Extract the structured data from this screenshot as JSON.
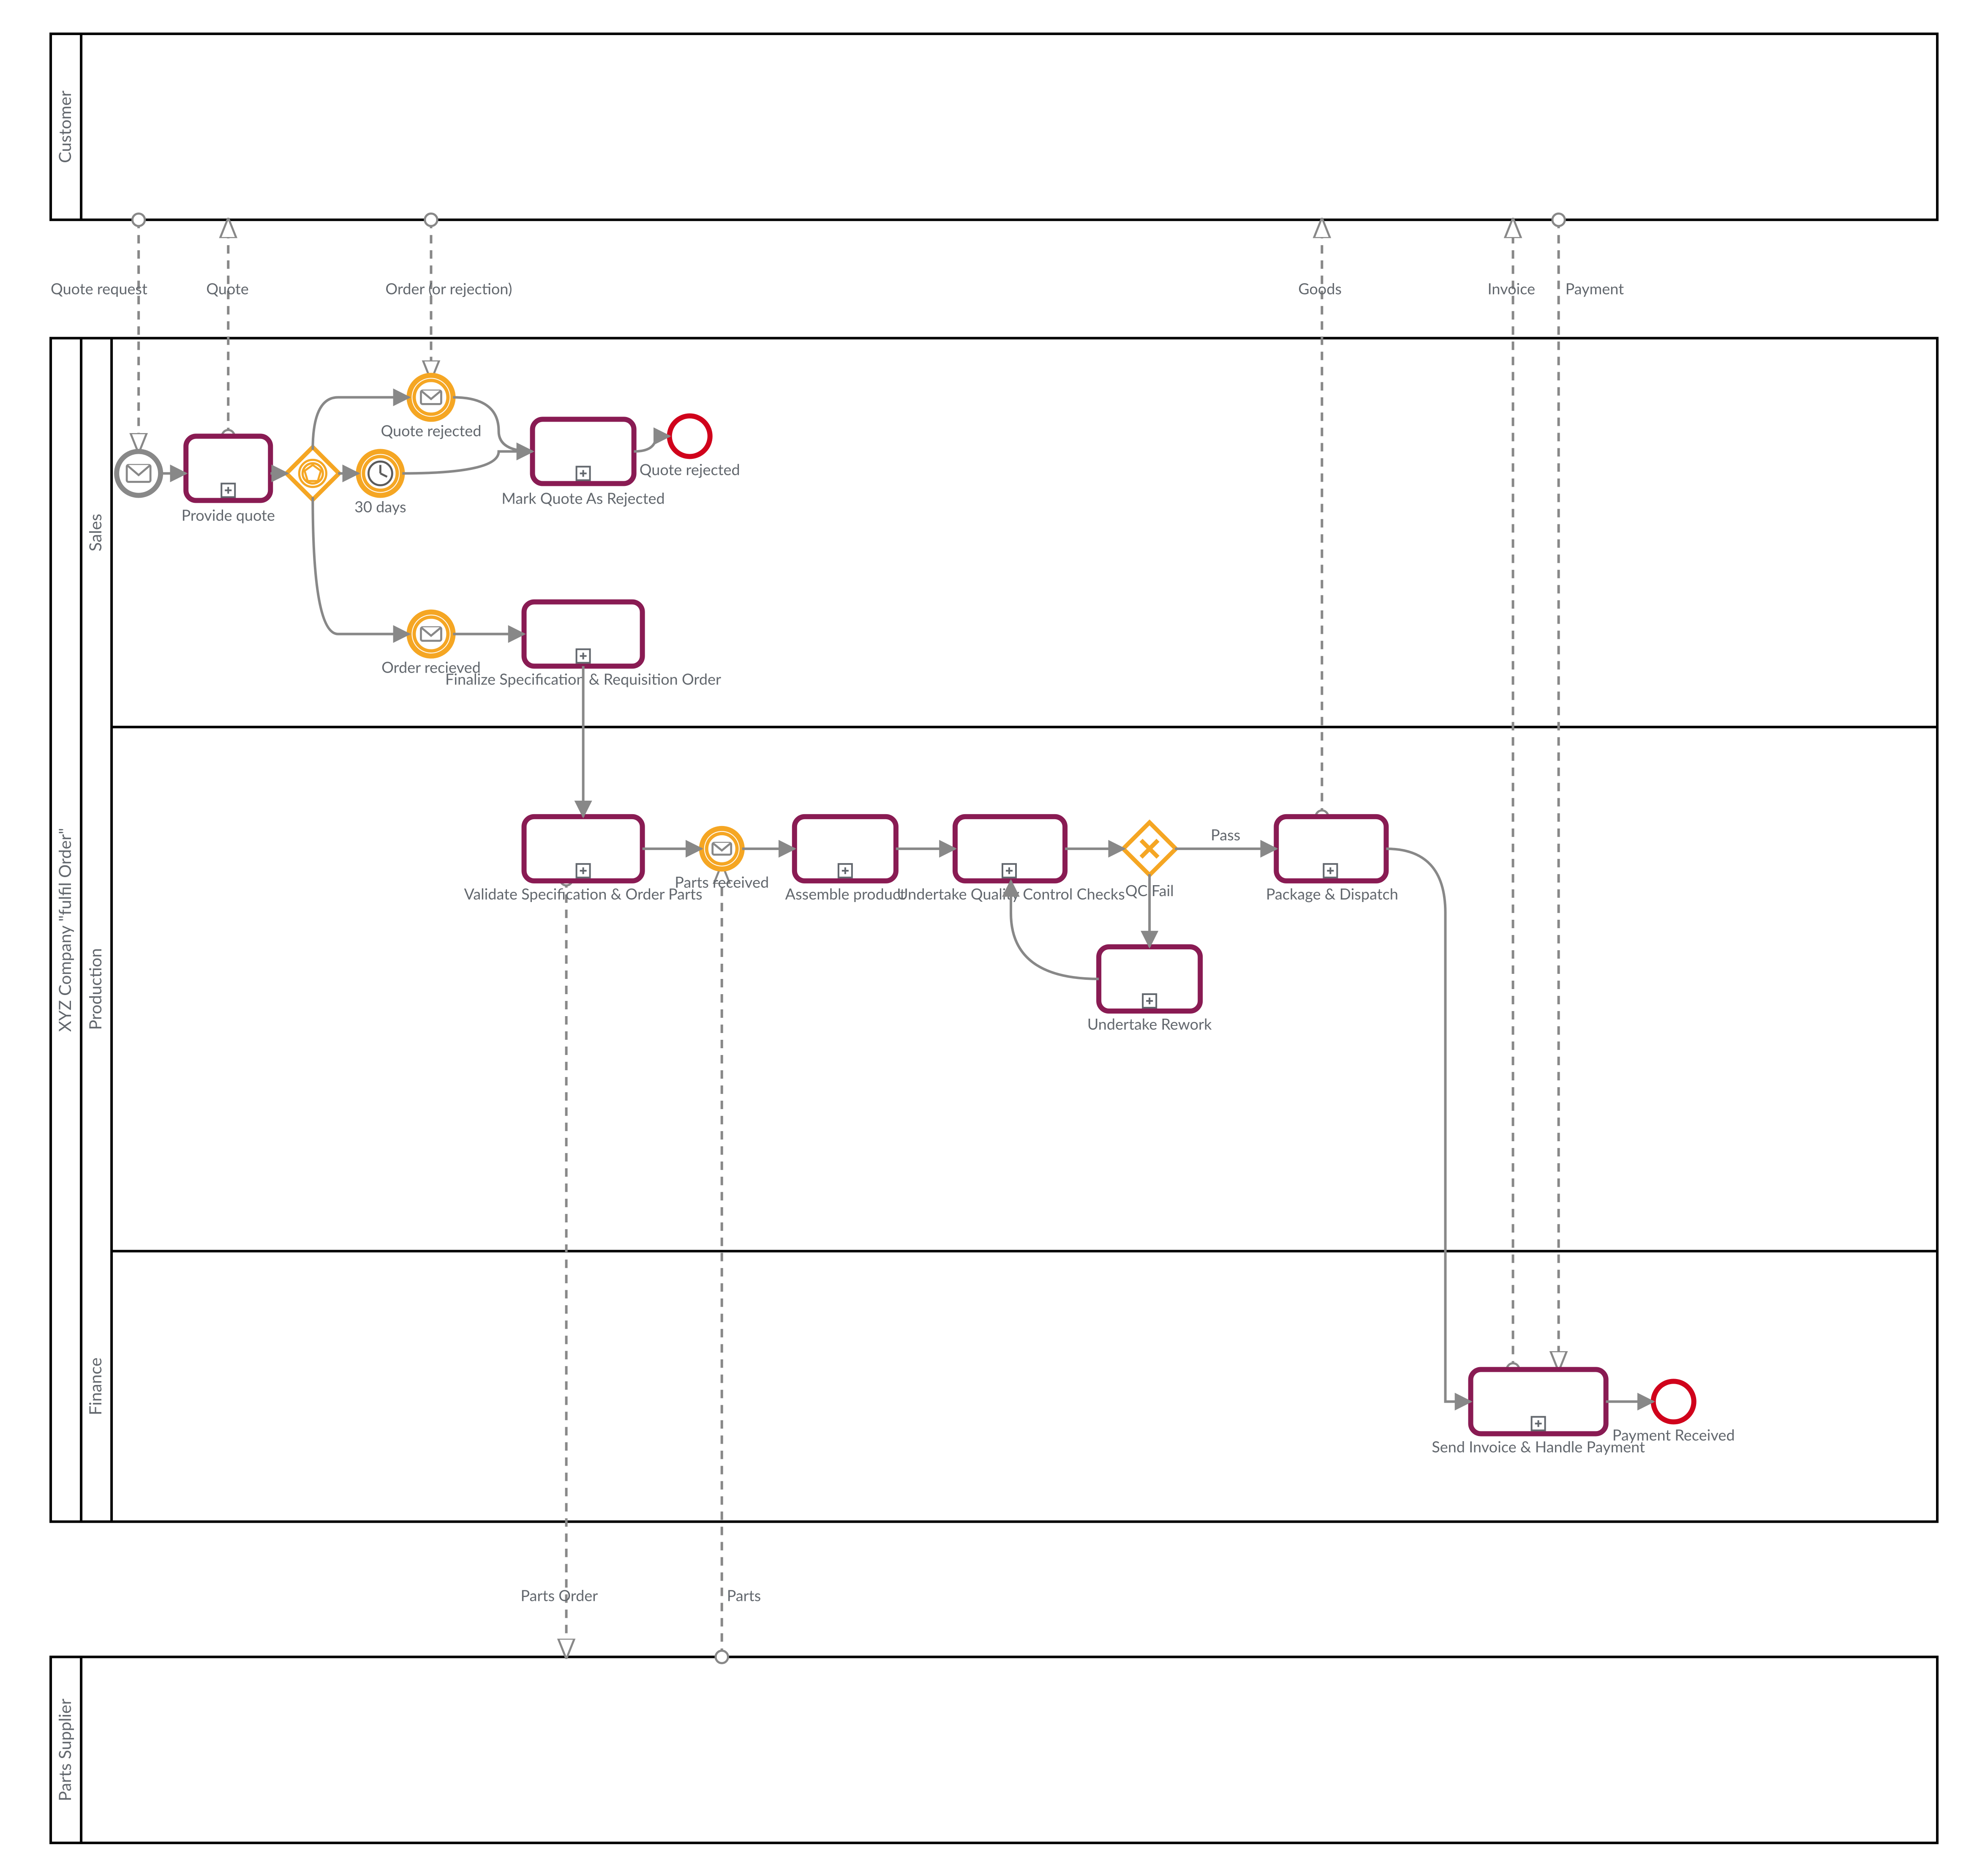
{
  "pools": {
    "customer": "Customer",
    "company": "XYZ Company \"fulfil Order\"",
    "supplier": "Parts Supplier"
  },
  "lanes": {
    "sales": "Sales",
    "production": "Production",
    "finance": "Finance"
  },
  "events": {
    "start": "",
    "quoteRejected": "Quote rejected",
    "thirtyDays": "30 days",
    "orderReceived": "Order recieved",
    "partsReceived": "Parts received",
    "endReject": "Quote rejected",
    "endPay": "Payment Received"
  },
  "tasks": {
    "provideQuote": "Provide quote",
    "markRejected": "Mark Quote As Rejected",
    "finalizeSpec": "Finalize Specification & Requisition Order",
    "validateOrder": "Validate Specification & Order Parts",
    "assemble": "Assemble product",
    "qcChecks": "Undertake Quality Control Checks",
    "rework": "Undertake Rework",
    "dispatch": "Package & Dispatch",
    "invoice": "Send Invoice & Handle Payment"
  },
  "gateways": {
    "qc": "QC Fail",
    "pass": "Pass"
  },
  "messages": {
    "quoteRequest": "Quote request",
    "quote": "Quote",
    "orderOrRej": "Order (or rejection)",
    "goods": "Goods",
    "invoice": "Invoice",
    "payment": "Payment",
    "partsOrder": "Parts Order",
    "parts": "Parts"
  }
}
